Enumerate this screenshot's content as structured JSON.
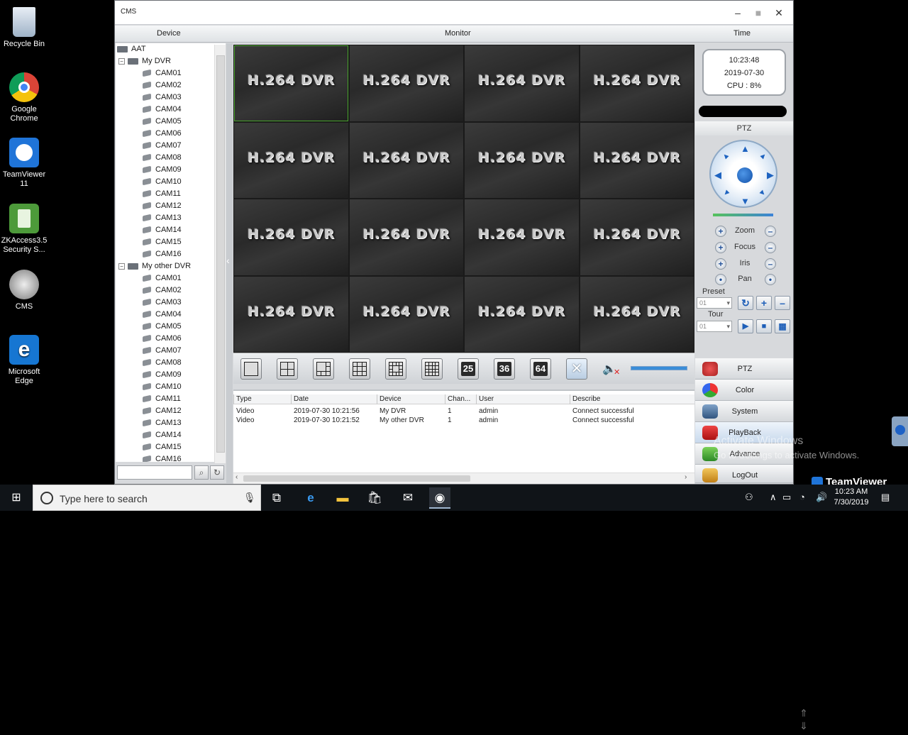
{
  "desktop": {
    "icons": [
      {
        "label": "Recycle Bin"
      },
      {
        "label": "Google Chrome"
      },
      {
        "label": "TeamViewer 11"
      },
      {
        "label": "ZKAccess3.5 Security S..."
      },
      {
        "label": "CMS"
      },
      {
        "label": "Microsoft Edge"
      }
    ]
  },
  "window": {
    "title": "CMS",
    "headers": {
      "device": "Device",
      "monitor": "Monitor",
      "time": "Time"
    }
  },
  "tree": {
    "root": "AAT",
    "groups": [
      {
        "label": "My DVR",
        "cams": [
          "CAM01",
          "CAM02",
          "CAM03",
          "CAM04",
          "CAM05",
          "CAM06",
          "CAM07",
          "CAM08",
          "CAM09",
          "CAM10",
          "CAM11",
          "CAM12",
          "CAM13",
          "CAM14",
          "CAM15",
          "CAM16"
        ]
      },
      {
        "label": "My other DVR",
        "cams": [
          "CAM01",
          "CAM02",
          "CAM03",
          "CAM04",
          "CAM05",
          "CAM06",
          "CAM07",
          "CAM08",
          "CAM09",
          "CAM10",
          "CAM11",
          "CAM12",
          "CAM13",
          "CAM14",
          "CAM15",
          "CAM16"
        ]
      }
    ]
  },
  "video": {
    "placeholder": "H.264 DVR",
    "selected_index": 0,
    "count": 16
  },
  "layout_buttons": {
    "n25": "25",
    "n36": "36",
    "n64": "64"
  },
  "log": {
    "columns": [
      "Type",
      "Date",
      "Device",
      "Chan...",
      "User",
      "Describe"
    ],
    "rows": [
      [
        "Video",
        "2019-07-30 10:21:56",
        "My DVR",
        "1",
        "admin",
        "Connect successful"
      ],
      [
        "Video",
        "2019-07-30 10:21:52",
        "My other DVR",
        "1",
        "admin",
        "Connect successful"
      ]
    ]
  },
  "status": {
    "time": "10:23:48",
    "date": "2019-07-30",
    "cpu": "CPU : 8%"
  },
  "ptz": {
    "title": "PTZ",
    "zoom": "Zoom",
    "focus": "Focus",
    "iris": "Iris",
    "pan": "Pan",
    "preset_label": "Preset",
    "preset_value": "01",
    "tour_label": "Tour",
    "tour_value": "01"
  },
  "menu": [
    {
      "label": "PTZ"
    },
    {
      "label": "Color"
    },
    {
      "label": "System"
    },
    {
      "label": "PlayBack"
    },
    {
      "label": "Advance"
    },
    {
      "label": "LogOut"
    }
  ],
  "watermark": {
    "line1": "Activate Windows",
    "line2": "Go to Settings to activate Windows."
  },
  "teamviewer_badge": "TeamViewer",
  "taskbar": {
    "search_placeholder": "Type here to search",
    "time": "10:23 AM",
    "date": "7/30/2019"
  },
  "colors": {
    "selected_cell_outline": "#4aa52e",
    "ptz_accent": "#1e63c0"
  }
}
